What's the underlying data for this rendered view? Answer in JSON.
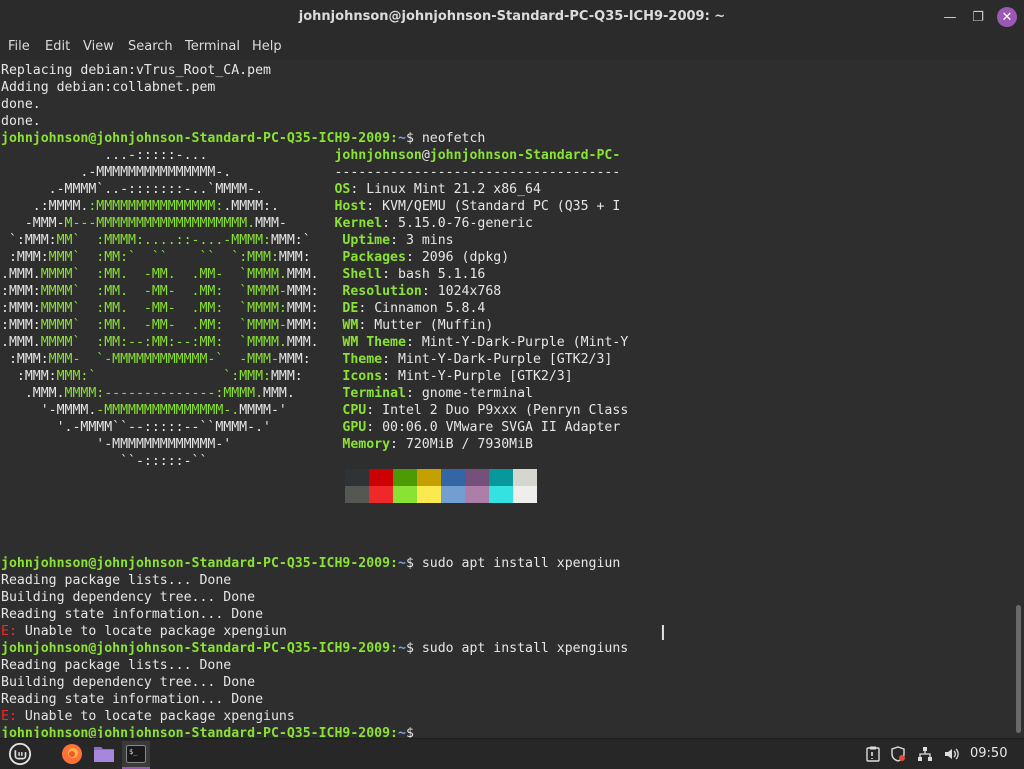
{
  "window": {
    "title": "johnjohnson@johnjohnson-Standard-PC-Q35-ICH9-2009: ~"
  },
  "menu": [
    "File",
    "Edit",
    "View",
    "Search",
    "Terminal",
    "Help"
  ],
  "terminal": {
    "lines": [
      [
        {
          "t": "Replacing debian:vTrus_Root_CA.pem",
          "c": "w"
        }
      ],
      [
        {
          "t": "Adding debian:collabnet.pem",
          "c": "w"
        }
      ],
      [
        {
          "t": "done.",
          "c": "w"
        }
      ],
      [
        {
          "t": "done.",
          "c": "w"
        }
      ],
      [
        {
          "t": "johnjohnson@johnjohnson-Standard-PC-Q35-ICH9-2009:",
          "c": "g"
        },
        {
          "t": "~",
          "c": "b"
        },
        {
          "t": "$ neofetch",
          "c": "w"
        }
      ],
      [
        {
          "t": "             ...-:::::-...                ",
          "c": "w"
        },
        {
          "t": "johnjohnson",
          "c": "g"
        },
        {
          "t": "@",
          "c": "w"
        },
        {
          "t": "johnjohnson-Standard-PC-",
          "c": "g"
        }
      ],
      [
        {
          "t": "          .-MMMMMMMMMMMMMMM-.             ",
          "c": "w"
        },
        {
          "t": "------------------------------------",
          "c": "w"
        }
      ],
      [
        {
          "t": "      .-MMMM`..-:::::::-..`MMMM-.         ",
          "c": "w"
        },
        {
          "t": "OS",
          "c": "g"
        },
        {
          "t": ": Linux Mint 21.2 x86_64",
          "c": "w"
        }
      ],
      [
        {
          "t": "    .:MMMM.",
          "c": "w"
        },
        {
          "t": ":MMMMMMMMMMMMMMM:",
          "c": "gl"
        },
        {
          "t": ".MMMM:.       ",
          "c": "w"
        },
        {
          "t": "Host",
          "c": "g"
        },
        {
          "t": ": KVM/QEMU (Standard PC (Q35 + I",
          "c": "w"
        }
      ],
      [
        {
          "t": "   -MMM-",
          "c": "w"
        },
        {
          "t": "M---MMMMMMMMMMMMMMMMMMM.",
          "c": "gl"
        },
        {
          "t": "MMM-      ",
          "c": "w"
        },
        {
          "t": "Kernel",
          "c": "g"
        },
        {
          "t": ": 5.15.0-76-generic",
          "c": "w"
        }
      ],
      [
        {
          "t": " `:MMM:",
          "c": "w"
        },
        {
          "t": "MM`  :MMMM:....::-...-MMMM:",
          "c": "gl"
        },
        {
          "t": "MMM:`    ",
          "c": "w"
        },
        {
          "t": "Uptime",
          "c": "g"
        },
        {
          "t": ": 3 mins",
          "c": "w"
        }
      ],
      [
        {
          "t": " :MMM:",
          "c": "w"
        },
        {
          "t": "MMM`  :MM:`  ``    ``  `:MMM:",
          "c": "gl"
        },
        {
          "t": "MMM:    ",
          "c": "w"
        },
        {
          "t": "Packages",
          "c": "g"
        },
        {
          "t": ": 2096 (dpkg)",
          "c": "w"
        }
      ],
      [
        {
          "t": ".MMM.",
          "c": "w"
        },
        {
          "t": "MMMM`  :MM.  -MM.  .MM-  `MMMM.",
          "c": "gl"
        },
        {
          "t": "MMM.   ",
          "c": "w"
        },
        {
          "t": "Shell",
          "c": "g"
        },
        {
          "t": ": bash 5.1.16",
          "c": "w"
        }
      ],
      [
        {
          "t": ":MMM:",
          "c": "w"
        },
        {
          "t": "MMMM`  :MM.  -MM-  .MM:  `MMMM-",
          "c": "gl"
        },
        {
          "t": "MMM:   ",
          "c": "w"
        },
        {
          "t": "Resolution",
          "c": "g"
        },
        {
          "t": ": 1024x768",
          "c": "w"
        }
      ],
      [
        {
          "t": ":MMM:",
          "c": "w"
        },
        {
          "t": "MMMM`  :MM.  -MM-  .MM:  `MMMM:",
          "c": "gl"
        },
        {
          "t": "MMM:   ",
          "c": "w"
        },
        {
          "t": "DE",
          "c": "g"
        },
        {
          "t": ": Cinnamon 5.8.4",
          "c": "w"
        }
      ],
      [
        {
          "t": ":MMM:",
          "c": "w"
        },
        {
          "t": "MMMM`  :MM.  -MM-  .MM:  `MMMM-",
          "c": "gl"
        },
        {
          "t": "MMM:   ",
          "c": "w"
        },
        {
          "t": "WM",
          "c": "g"
        },
        {
          "t": ": Mutter (Muffin)",
          "c": "w"
        }
      ],
      [
        {
          "t": ".MMM.",
          "c": "w"
        },
        {
          "t": "MMMM`  :MM:--:MM:--:MM:  `MMMM.",
          "c": "gl"
        },
        {
          "t": "MMM.   ",
          "c": "w"
        },
        {
          "t": "WM Theme",
          "c": "g"
        },
        {
          "t": ": Mint-Y-Dark-Purple (Mint-Y",
          "c": "w"
        }
      ],
      [
        {
          "t": " :MMM:",
          "c": "w"
        },
        {
          "t": "MMM-  `-MMMMMMMMMMMM-`  -MMM-",
          "c": "gl"
        },
        {
          "t": "MMM:    ",
          "c": "w"
        },
        {
          "t": "Theme",
          "c": "g"
        },
        {
          "t": ": Mint-Y-Dark-Purple [GTK2/3]",
          "c": "w"
        }
      ],
      [
        {
          "t": "  :MMM:",
          "c": "w"
        },
        {
          "t": "MMM:`                `:MMM:",
          "c": "gl"
        },
        {
          "t": "MMM:     ",
          "c": "w"
        },
        {
          "t": "Icons",
          "c": "g"
        },
        {
          "t": ": Mint-Y-Purple [GTK2/3]",
          "c": "w"
        }
      ],
      [
        {
          "t": "   .MMM.",
          "c": "w"
        },
        {
          "t": "MMMM:--------------:MMMM.",
          "c": "gl"
        },
        {
          "t": "MMM.      ",
          "c": "w"
        },
        {
          "t": "Terminal",
          "c": "g"
        },
        {
          "t": ": gnome-terminal",
          "c": "w"
        }
      ],
      [
        {
          "t": "     '-MMMM.",
          "c": "w"
        },
        {
          "t": "-MMMMMMMMMMMMMMM-.",
          "c": "gl"
        },
        {
          "t": "MMMM-'       ",
          "c": "w"
        },
        {
          "t": "CPU",
          "c": "g"
        },
        {
          "t": ": Intel 2 Duo P9xxx (Penryn Class",
          "c": "w"
        }
      ],
      [
        {
          "t": "       '.-MMMM``--:::::--``MMMM-.'         ",
          "c": "w"
        },
        {
          "t": "GPU",
          "c": "g"
        },
        {
          "t": ": 00:06.0 VMware SVGA II Adapter",
          "c": "w"
        }
      ],
      [
        {
          "t": "            '-MMMMMMMMMMMMM-'              ",
          "c": "w"
        },
        {
          "t": "Memory",
          "c": "g"
        },
        {
          "t": ": 720MiB / 7930MiB",
          "c": "w"
        }
      ],
      [
        {
          "t": "               ``-:::::-``",
          "c": "w"
        }
      ],
      [],
      [],
      [],
      [],
      [],
      [
        {
          "t": "johnjohnson@johnjohnson-Standard-PC-Q35-ICH9-2009:",
          "c": "g"
        },
        {
          "t": "~",
          "c": "b"
        },
        {
          "t": "$ sudo apt install xpengiun",
          "c": "w"
        }
      ],
      [
        {
          "t": "Reading package lists... Done",
          "c": "w"
        }
      ],
      [
        {
          "t": "Building dependency tree... Done",
          "c": "w"
        }
      ],
      [
        {
          "t": "Reading state information... Done",
          "c": "w"
        }
      ],
      [
        {
          "t": "E: ",
          "c": "r"
        },
        {
          "t": "Unable to locate package xpengiun",
          "c": "w"
        }
      ],
      [
        {
          "t": "johnjohnson@johnjohnson-Standard-PC-Q35-ICH9-2009:",
          "c": "g"
        },
        {
          "t": "~",
          "c": "b"
        },
        {
          "t": "$ sudo apt install xpengiuns",
          "c": "w"
        }
      ],
      [
        {
          "t": "Reading package lists... Done",
          "c": "w"
        }
      ],
      [
        {
          "t": "Building dependency tree... Done",
          "c": "w"
        }
      ],
      [
        {
          "t": "Reading state information... Done",
          "c": "w"
        }
      ],
      [
        {
          "t": "E: ",
          "c": "r"
        },
        {
          "t": "Unable to locate package xpengiuns",
          "c": "w"
        }
      ],
      [
        {
          "t": "johnjohnson@johnjohnson-Standard-PC-Q35-ICH9-2009:",
          "c": "g"
        },
        {
          "t": "~",
          "c": "b"
        },
        {
          "t": "$ ",
          "c": "w"
        }
      ]
    ],
    "palette_top": [
      "#2e3436",
      "#cc0000",
      "#4e9a06",
      "#c4a000",
      "#3465a4",
      "#75507b",
      "#06989a",
      "#d3d7cf"
    ],
    "palette_bottom": [
      "#555753",
      "#ef2929",
      "#8ae234",
      "#fce94f",
      "#729fcf",
      "#ad7fa8",
      "#34e2e2",
      "#eeeeec"
    ]
  },
  "taskbar": {
    "clock": "09:50",
    "accent": "#9b59b6"
  }
}
